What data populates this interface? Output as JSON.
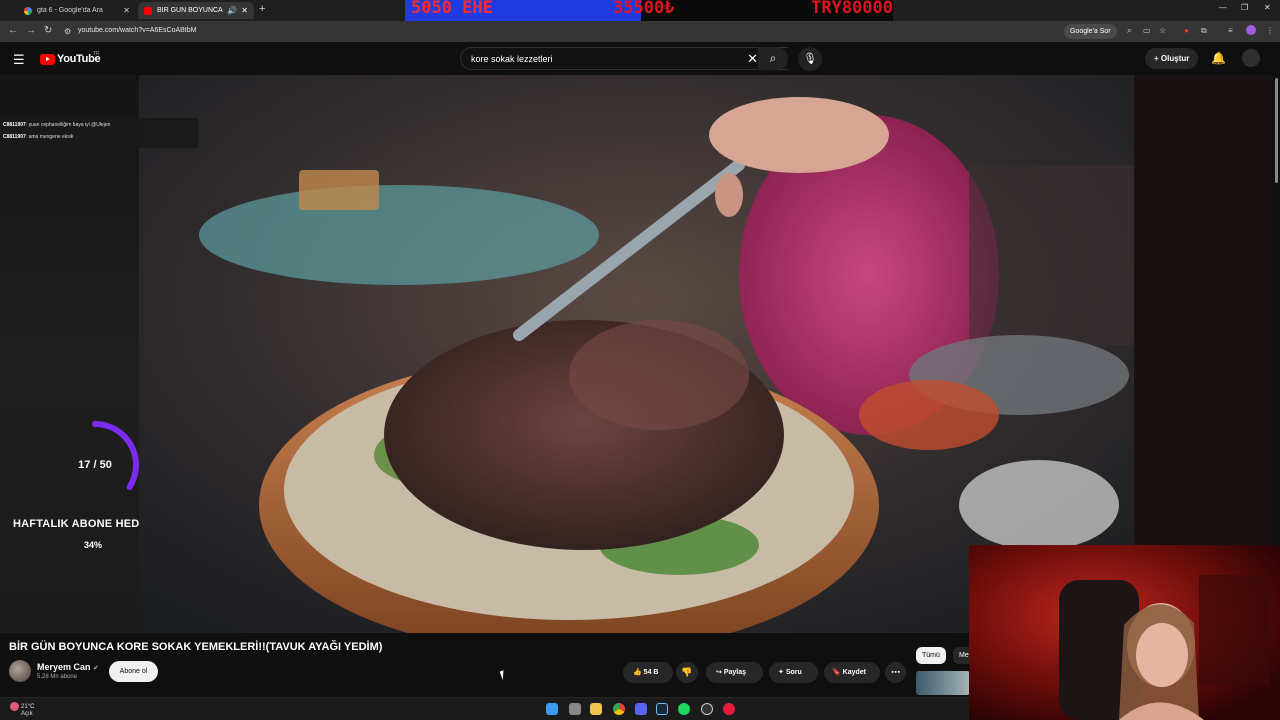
{
  "browser": {
    "tabs": [
      {
        "title": "gta 6 - Google'da Ara",
        "active": false
      },
      {
        "title": "BİR GÜN BOYUNCA KORE",
        "active": true
      }
    ],
    "url": "youtube.com/watch?v=A6EsCoABtbM",
    "google_sor": "Google'a Sor"
  },
  "stream_banner": {
    "left_text": "5050 EHE",
    "mid_text": "35500₺",
    "right_text": "TRY80000"
  },
  "youtube": {
    "logo_text": "YouTube",
    "country_code": "TR",
    "search_value": "kore sokak lezzetleri",
    "create_label": "Oluştur"
  },
  "chat": [
    {
      "user": "C8811907",
      "text": "şuan cephanelliğim baya iyi @Ulejen"
    },
    {
      "user": "C8811907",
      "text": "ama mengene eksik"
    }
  ],
  "sub_goal": {
    "current": 17,
    "target": 50,
    "count_text": "17 / 50",
    "title": "HAFTALIK ABONE HEDEFI",
    "percent_text": "34%",
    "progress": 0.34,
    "color": "#7a2cf0"
  },
  "video": {
    "title": "BİR GÜN BOYUNCA KORE SOKAK YEMEKLERİ!!(TAVUK AYAĞI YEDİM)",
    "channel": "Meryem Can",
    "subscribers": "5,28 Mn abone",
    "subscribe_label": "Abone ol",
    "likes": "54 B",
    "share_label": "Paylaş",
    "ask_label": "Soru",
    "save_label": "Kaydet"
  },
  "chips": {
    "all": "Tümü",
    "second": "Me"
  },
  "taskbar": {
    "temp": "21°C",
    "weather": "Açık"
  },
  "colors": {
    "yt_red": "#ff0000",
    "banner_blue": "#1f3be0",
    "banner_red": "#ff2a2a",
    "bg": "#0f0f0f"
  }
}
